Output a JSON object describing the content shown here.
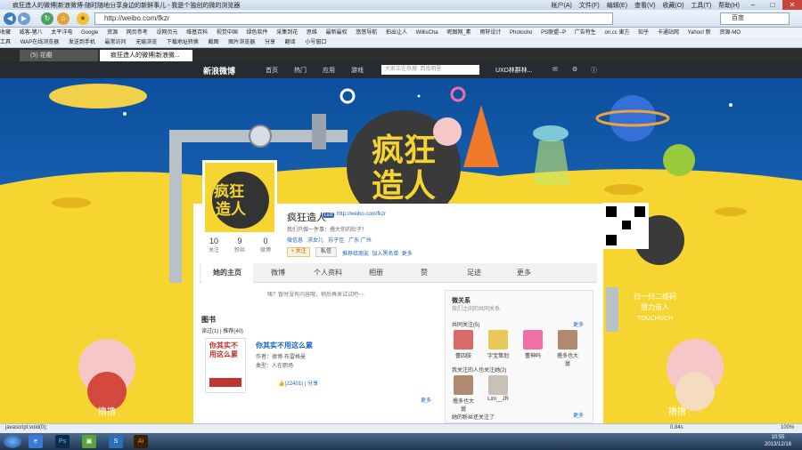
{
  "browser": {
    "window_title": "疯狂造人的微博|新浪微博-随时随地分享身边的新鲜事儿 - 我是个独创的微的浏览器",
    "menu": [
      "帐户(A)",
      "文件(F)",
      "编辑(E)",
      "查看(V)",
      "收藏(O)",
      "工具(T)",
      "帮助(H)"
    ],
    "url": "http://weibo.com/fkzr",
    "search_placeholder": "百度",
    "favorites": [
      "收藏",
      "威客-猪八",
      "太平洋电",
      "Google",
      "资源",
      "网页参考",
      "设网页元",
      "维基百科",
      "视觉中国",
      "绿色软件",
      "采集到花",
      "思维",
      "最新最权",
      "悠悠导航",
      "拍出让人",
      "WillisCha",
      "昵图网_素",
      "雨轩设计",
      "Photosho",
      "PS联盟--P",
      "广告特生",
      "on.cc 東方",
      "知乎",
      "卡通站网",
      "Yahoo! 新",
      "资源-MO"
    ],
    "toolbar2": [
      "工具",
      "WAP在线浏览器",
      "发送到手机",
      "最常访问",
      "无痕浏览",
      "下载地址转换",
      "截图",
      "图片浏览器",
      "分享",
      "翻译",
      "小号窗口"
    ],
    "tabs": [
      {
        "label": "(5) 花瓣"
      },
      {
        "label": "疯狂造人的微博|新浪微..."
      }
    ],
    "status_left": "javascript:void(0);",
    "status_right": "0.84s",
    "zoom": "100%"
  },
  "weibo_nav": {
    "logo": "新浪微博",
    "items": [
      "首页",
      "热门",
      "应用",
      "游戏"
    ],
    "search_placeholder": "大家正在热搜: 西南明星",
    "user": "UXD林群林..."
  },
  "banner": {
    "logo_line1": "疯狂",
    "logo_line2": "造人",
    "qr_caption_line1": "扫一扫二维码",
    "qr_caption_line2": "撸力造人",
    "qr_caption_line3": "TOUCHUCH",
    "pull_label": "撸撸"
  },
  "profile": {
    "name": "疯狂造人",
    "level": "Lv.8",
    "url": "http://weibo.com/fkzr",
    "bio": "我们只做一件事：撸大你的肚子！",
    "tags": [
      "微信息",
      "求女儿",
      "苏子佳",
      "广东 广州"
    ],
    "follow_btn": "+ 关注",
    "msg_btn": "私信",
    "links": [
      "推荐给朋友",
      "加入黑名单",
      "更多"
    ],
    "counts": [
      {
        "n": "10",
        "label": "关注"
      },
      {
        "n": "9",
        "label": "粉丝"
      },
      {
        "n": "0",
        "label": "微博"
      }
    ],
    "tabs": [
      "她的主页",
      "微博",
      "个人资料",
      "相册",
      "赞",
      "足迹",
      "更多"
    ],
    "notice": "咦？暂时没有内容哦，稍后再来试试吧~~"
  },
  "books": {
    "title": "图书",
    "filters": [
      "读过(1)",
      "推荐(40)"
    ],
    "book_title": "你其实不用这么累",
    "cover_text": "你其实不用这么累",
    "author": "作者：德博·布雷格曼",
    "category": "类型：人在职场",
    "likes": "(22401)",
    "share": "分享",
    "more": "更多"
  },
  "sidebar": {
    "title": "微关系",
    "subtitle": "我们之间的共同关系",
    "common_follow": "共同关注(5)",
    "more": "更多",
    "friends1": [
      {
        "name": "蕾四肢",
        "color": "#d86a6a"
      },
      {
        "name": "字宝策划",
        "color": "#e8c85a"
      },
      {
        "name": "蕾神吗",
        "color": "#f06fa6"
      },
      {
        "name": "撸多也大舅",
        "color": "#b08970"
      }
    ],
    "also_follow": "我关注的人也关注她(2)",
    "friends2": [
      {
        "name": "撸多也大舅",
        "color": "#b08970"
      },
      {
        "name": "Lim__JR",
        "color": "#c9c0b6"
      }
    ],
    "recent": "她的粉丝还关注了"
  },
  "taskbar": {
    "time": "10:55",
    "date": "2013/12/16",
    "apps": [
      "Ps",
      "Ai"
    ]
  },
  "colors": {
    "sky": "#1a66b6",
    "moon": "#f7d531",
    "accent": "#eb7350"
  }
}
